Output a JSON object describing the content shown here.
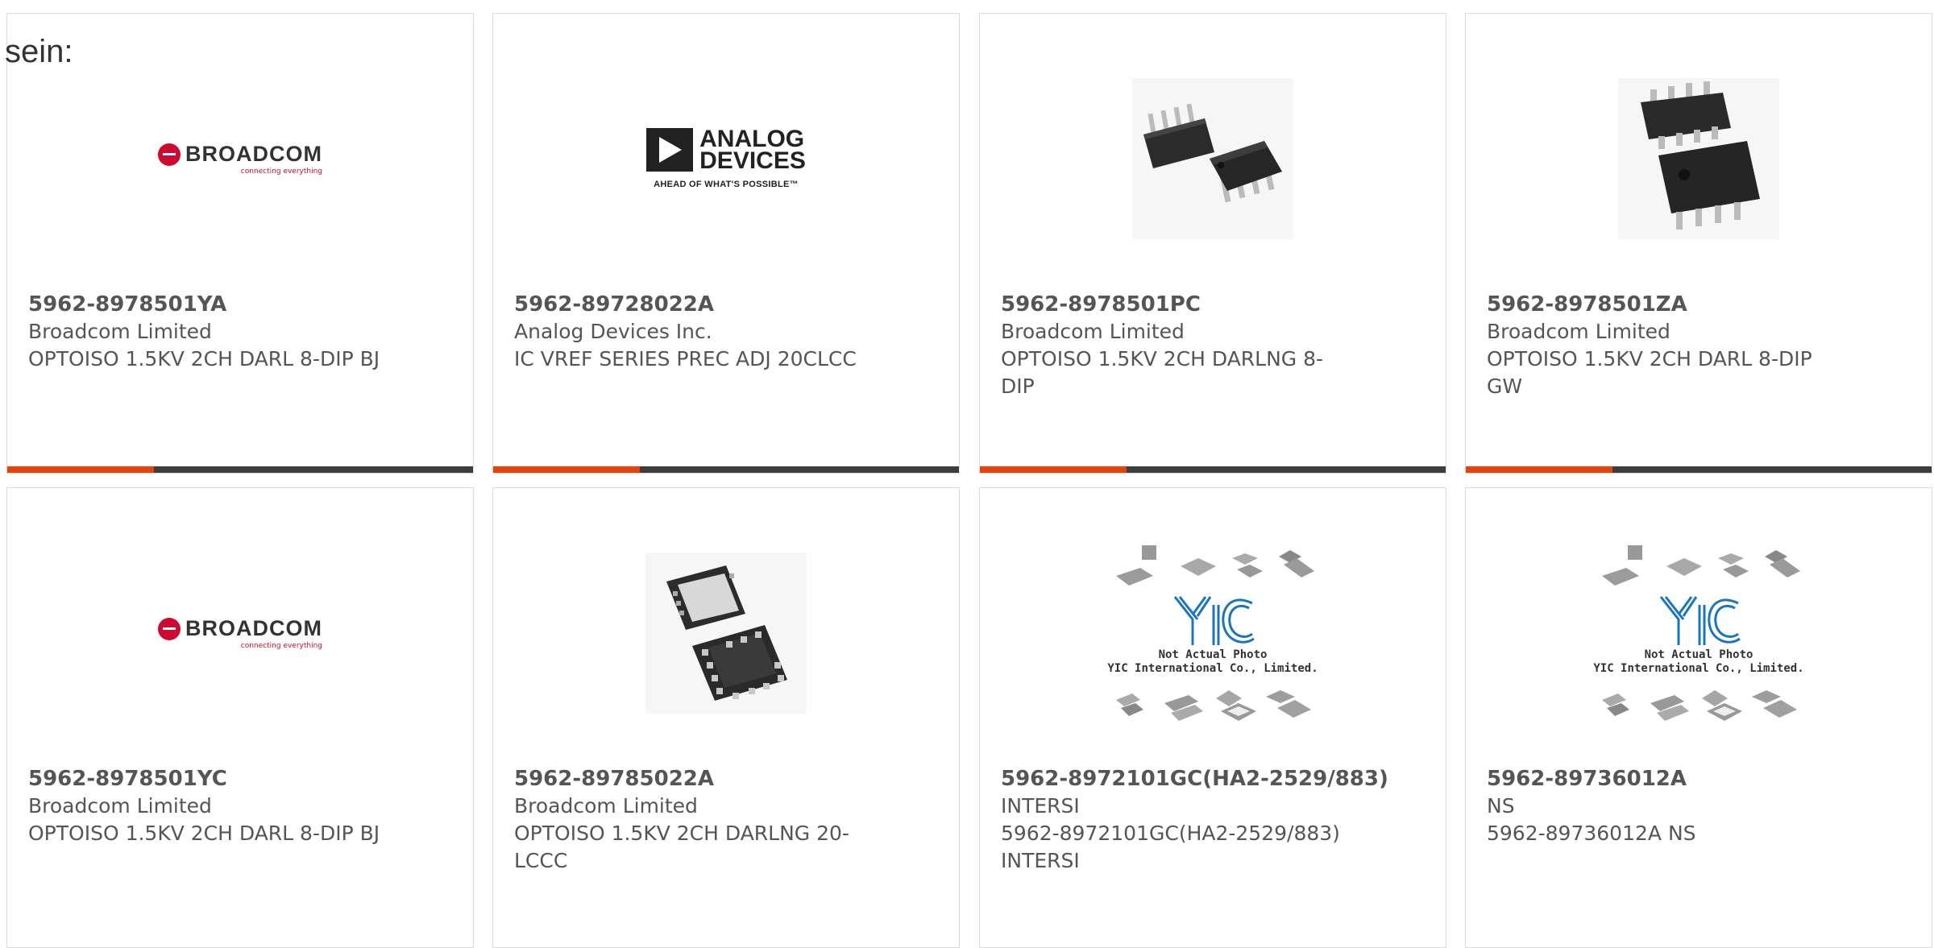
{
  "lead_text": "sein:",
  "colors": {
    "accent": "#e8420c",
    "bar": "#3d3d3d",
    "broadcom_red": "#cc092f",
    "yic_blue": "#1b75bc"
  },
  "products": [
    {
      "part_number": "5962-8978501YA",
      "manufacturer": "Broadcom Limited",
      "description": "OPTOISO 1.5KV 2CH DARL 8-DIP BJ",
      "image": "broadcom-logo"
    },
    {
      "part_number": "5962-89728022A",
      "manufacturer": "Analog Devices Inc.",
      "description": "IC VREF SERIES PREC ADJ 20CLCC",
      "image": "analog-devices-logo"
    },
    {
      "part_number": "5962-8978501PC",
      "manufacturer": "Broadcom Limited",
      "description": "OPTOISO 1.5KV 2CH DARLNG 8-DIP",
      "image": "dip8-chip-photo"
    },
    {
      "part_number": "5962-8978501ZA",
      "manufacturer": "Broadcom Limited",
      "description": "OPTOISO 1.5KV 2CH DARL 8-DIP GW",
      "image": "smd8-chip-photo"
    },
    {
      "part_number": "5962-8978501YC",
      "manufacturer": "Broadcom Limited",
      "description": "OPTOISO 1.5KV 2CH DARL 8-DIP BJ",
      "image": "broadcom-logo"
    },
    {
      "part_number": "5962-89785022A",
      "manufacturer": "Broadcom Limited",
      "description": "OPTOISO 1.5KV 2CH DARLNG 20-LCCC",
      "image": "lccc20-chip-photo"
    },
    {
      "part_number": "5962-8972101GC(HA2-2529/883)",
      "manufacturer": "INTERSI",
      "description": "5962-8972101GC(HA2-2529/883) INTERSI",
      "image": "yic-placeholder"
    },
    {
      "part_number": "5962-89736012A",
      "manufacturer": "NS",
      "description": "5962-89736012A NS",
      "image": "yic-placeholder"
    }
  ],
  "logos": {
    "broadcom": {
      "name": "BROADCOM",
      "tagline": "connecting everything"
    },
    "analog_devices": {
      "line1": "ANALOG",
      "line2": "DEVICES",
      "tagline": "AHEAD OF WHAT'S POSSIBLE™"
    },
    "yic": {
      "mark": "YIC",
      "line1": "Not Actual Photo",
      "line2": "YIC International Co., Limited."
    }
  }
}
